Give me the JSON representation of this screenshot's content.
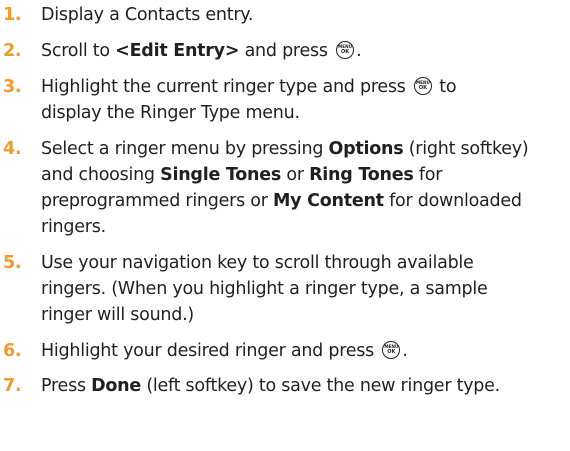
{
  "colors": {
    "step_number": "#f39a2b",
    "text": "#231f20"
  },
  "icons": {
    "menu_ok_key": "menu-ok-key-icon"
  },
  "menu_key": {
    "top": "MENU",
    "bottom": "OK"
  },
  "steps": [
    {
      "number": "1.",
      "text": "Display a Contacts entry."
    },
    {
      "number": "2.",
      "t1": "Scroll to ",
      "b1": "<Edit Entry>",
      "t2": " and press "
    },
    {
      "number": "3.",
      "t1": "Highlight the current ringer type and press ",
      "t2": " to",
      "t3": "display the Ringer Type menu."
    },
    {
      "number": "4.",
      "t1": "Select a ringer menu by pressing ",
      "b1": "Options",
      "t2": " (right softkey)",
      "t3": "and choosing ",
      "b2": "Single Tones",
      "t4": " or ",
      "b3": "Ring Tones",
      "t5": " for",
      "t6": "preprogrammed ringers or ",
      "b4": "My Content",
      "t7": " for downloaded",
      "t8": "ringers."
    },
    {
      "number": "5.",
      "l1": "Use your navigation key to scroll through available",
      "l2": "ringers. (When you highlight a ringer type, a sample",
      "l3": "ringer will sound.)"
    },
    {
      "number": "6.",
      "t1": "Highlight your desired ringer and press "
    },
    {
      "number": "7.",
      "t1": "Press ",
      "b1": "Done",
      "t2": " (left softkey) to save the new ringer type."
    }
  ]
}
